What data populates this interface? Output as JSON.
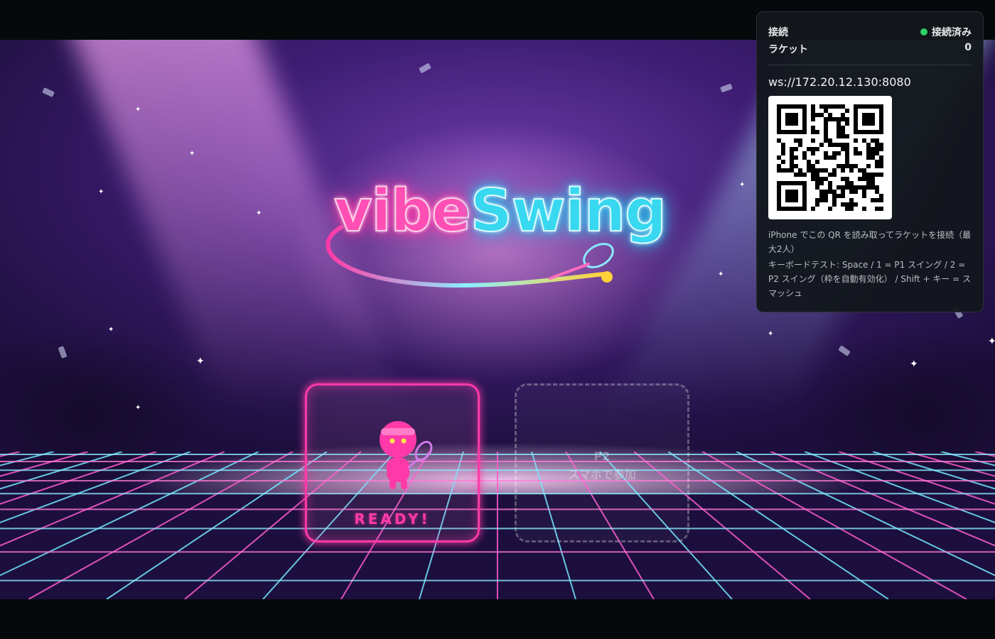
{
  "game": {
    "logo_part1": "vibe",
    "logo_part2": "Swing"
  },
  "slots": {
    "p1": {
      "status": "READY!"
    },
    "p2": {
      "name": "P2",
      "hint": "スマホで参加"
    }
  },
  "panel": {
    "connection_label": "接続",
    "connection_status": "接続済み",
    "racket_label": "ラケット",
    "racket_count": "0",
    "ws_url": "ws://172.20.12.130:8080",
    "hint_qr": "iPhone でこの QR を読み取ってラケットを接続（最大2人）",
    "hint_keyboard": "キーボードテスト: Space / 1 = P1 スイング / 2 = P2 スイング（枠を自動有効化） / Shift + キー = スマッシュ"
  },
  "colors": {
    "accent_pink": "#ff3aa8",
    "accent_cyan": "#37d8f0",
    "status_connected": "#2fcf63",
    "panel_bg": "#13171c"
  },
  "icons": {
    "status": "status-dot-icon",
    "qr": "qr-code-icon",
    "racket": "tennis-racket-icon"
  }
}
